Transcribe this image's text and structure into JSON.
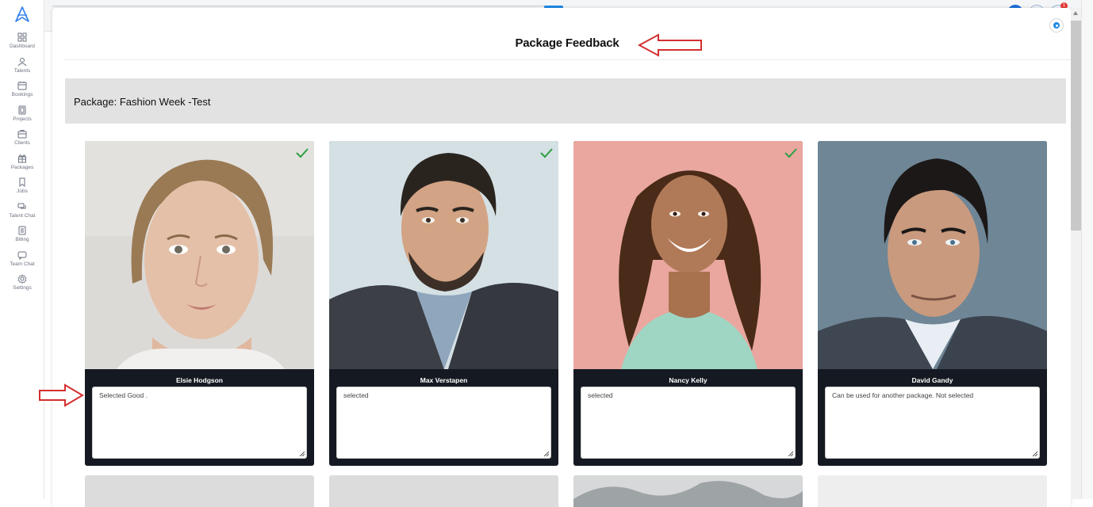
{
  "sidebar": {
    "items": [
      {
        "label": "Dashboard",
        "icon": "grid-icon"
      },
      {
        "label": "Talents",
        "icon": "talents-icon"
      },
      {
        "label": "Bookings",
        "icon": "calendar-icon"
      },
      {
        "label": "Projects",
        "icon": "projects-icon"
      },
      {
        "label": "Clients",
        "icon": "briefcase-icon"
      },
      {
        "label": "Packages",
        "icon": "gift-icon"
      },
      {
        "label": "Jobs",
        "icon": "bookmark-icon"
      },
      {
        "label": "Talent Chat",
        "icon": "chat-bubbles-icon"
      },
      {
        "label": "Billing",
        "icon": "billing-icon"
      },
      {
        "label": "Team Chat",
        "icon": "team-chat-icon"
      },
      {
        "label": "Settings",
        "icon": "gear-icon"
      }
    ]
  },
  "topbar": {
    "notification_count": "1"
  },
  "modal": {
    "title": "Package Feedback",
    "package_label": "Package: Fashion Week -Test"
  },
  "talents": [
    {
      "name": "Elsie Hodgson",
      "feedback": "Selected Good .",
      "selected": true
    },
    {
      "name": "Max Verstapen",
      "feedback": "selected",
      "selected": true
    },
    {
      "name": "Nancy Kelly",
      "feedback": "selected",
      "selected": true
    },
    {
      "name": "David Gandy",
      "feedback": "Can be used for another package. Not selected",
      "selected": false
    }
  ],
  "colors": {
    "accent": "#1e88e5",
    "check": "#2ea043",
    "annotation": "#d32f2f",
    "card_footer": "#151a22",
    "package_bar": "#e2e2e2"
  }
}
